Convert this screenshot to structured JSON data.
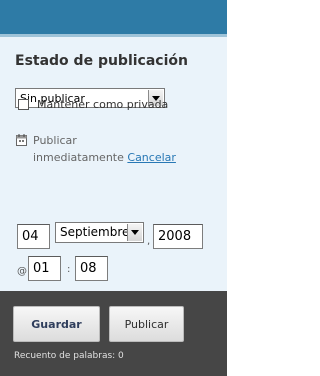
{
  "publish_box": {
    "title": "Estado de publicación",
    "status_select": {
      "value": "Sin publicar"
    },
    "private_checkbox": {
      "label": "Mantener como privada",
      "checked": false
    },
    "schedule": {
      "line1": "Publicar",
      "line2": "inmediatamente",
      "cancel_link": "Cancelar"
    },
    "date": {
      "day": "04",
      "month": "Septiembre",
      "year": "2008",
      "comma": ",",
      "at": "@",
      "hour": "01",
      "colon": ":",
      "minute": "08"
    }
  },
  "footer": {
    "save_label": "Guardar",
    "publish_label": "Publicar",
    "word_count_label": "Recuento de palabras: 0"
  },
  "colors": {
    "top_bar": "#2E7BA6",
    "panel_bg": "#EAF3FA",
    "footer_bg": "#464646",
    "link": "#2878B5"
  }
}
